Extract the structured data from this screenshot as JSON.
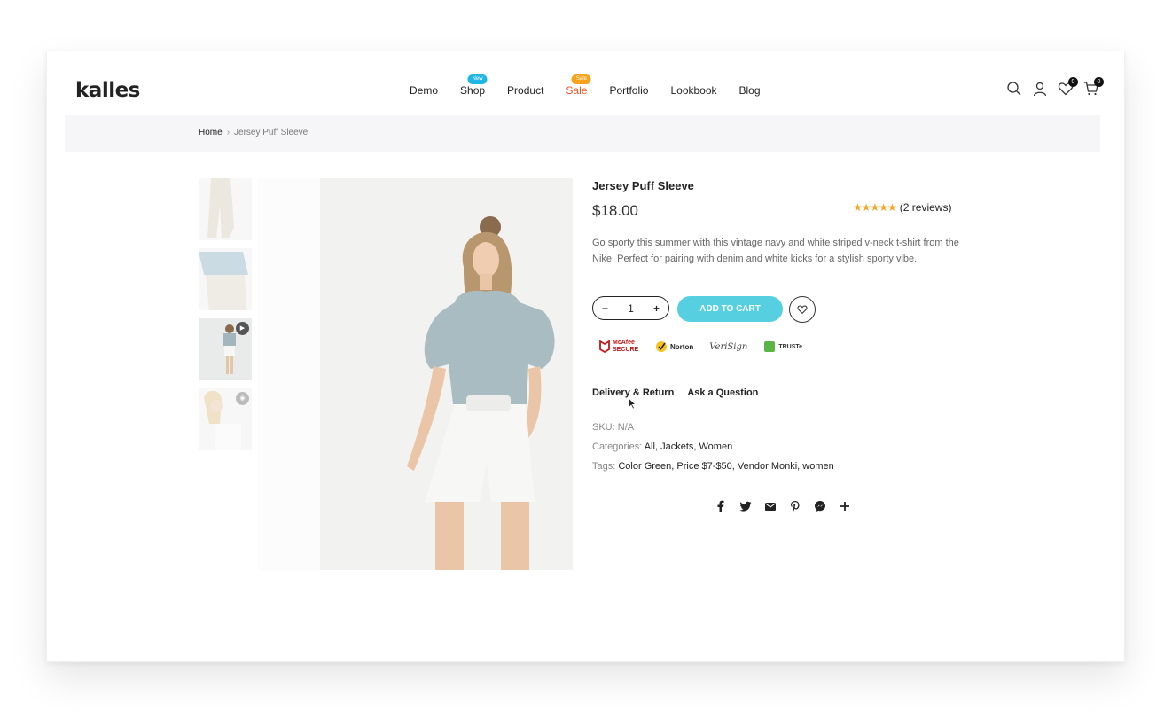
{
  "header": {
    "logo": "kalles",
    "nav": [
      {
        "label": "Demo",
        "badge": ""
      },
      {
        "label": "Shop",
        "badge": "New"
      },
      {
        "label": "Product",
        "badge": ""
      },
      {
        "label": "Sale",
        "badge": "Sale"
      },
      {
        "label": "Portfolio",
        "badge": ""
      },
      {
        "label": "Lookbook",
        "badge": ""
      },
      {
        "label": "Blog",
        "badge": ""
      }
    ],
    "wishlist_count": "0",
    "cart_count": "0",
    "icons": [
      "search-icon",
      "user-icon",
      "heart-icon",
      "cart-icon"
    ]
  },
  "breadcrumb": {
    "home": "Home",
    "separator": "›",
    "current": "Jersey Puff Sleeve"
  },
  "gallery": {
    "thumbnails": [
      "thumb-1",
      "thumb-2",
      "thumb-video",
      "thumb-360"
    ]
  },
  "product": {
    "title": "Jersey Puff Sleeve",
    "price": "$18.00",
    "stars": "★★★★★",
    "rating": 5,
    "reviews": "(2 reviews)",
    "description": "Go sporty this summer with this vintage navy and white striped v-neck t-shirt from the Nike. Perfect for pairing with denim and white kicks for a stylish sporty vibe.",
    "quantity": "1",
    "minus": "−",
    "plus": "+",
    "add_to_cart": "ADD TO CART",
    "trust_badges": [
      "McAfee SECURE",
      "Norton",
      "VeriSign",
      "TRUSTe"
    ],
    "tabs": [
      "Delivery & Return",
      "Ask a Question"
    ],
    "sku_label": "SKU:",
    "sku": "N/A",
    "categories_label": "Categories:",
    "categories": [
      "All",
      "Jackets",
      "Women"
    ],
    "tags_label": "Tags:",
    "tags": [
      "Color Green",
      "Price $7-$50",
      "Vendor Monki",
      "women"
    ]
  },
  "share": [
    "facebook-icon",
    "twitter-icon",
    "email-icon",
    "pinterest-icon",
    "messenger-icon",
    "plus-icon"
  ],
  "colors": {
    "accent": "#56cfe1",
    "sale": "#ec5425",
    "new_badge": "#1fb6e6",
    "sale_badge": "#f7a21a",
    "star": "#f5a623"
  }
}
